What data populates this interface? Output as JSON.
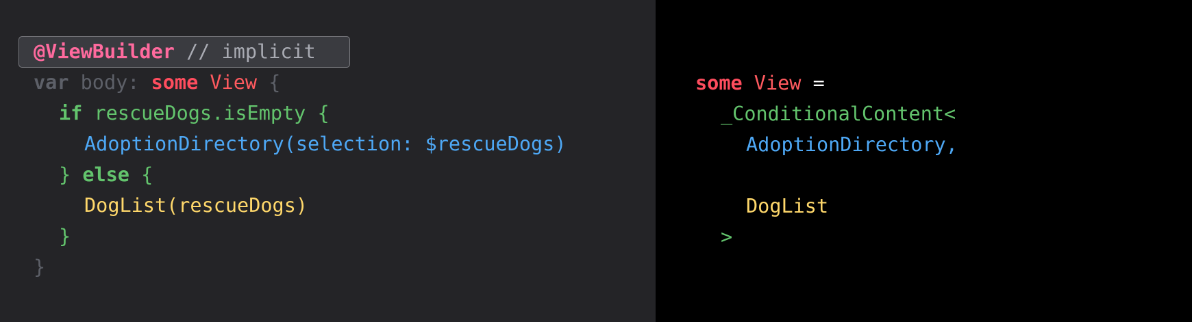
{
  "colors": {
    "left_background": "#242427",
    "right_background": "#000000",
    "keyword_pink": "#ff6a9e",
    "keyword_red": "#ff4d5e",
    "type_red": "#ff5a5f",
    "green": "#63c46d",
    "blue": "#4ea8f5",
    "yellow": "#ffd86b",
    "dim_gray": "#5d6068",
    "comment_gray": "#a9abb3",
    "white": "#ffffff"
  },
  "left_code": {
    "lines": [
      {
        "indent": 0,
        "tokens": [
          {
            "text": "@ViewBuilder",
            "color": "#ff6a9e",
            "bold": true
          },
          {
            "text": " // implicit",
            "color": "#a9abb3",
            "bold": false
          }
        ]
      },
      {
        "indent": 0,
        "tokens": [
          {
            "text": "var",
            "color": "#5d6068",
            "bold": true
          },
          {
            "text": " body: ",
            "color": "#5d6068",
            "bold": false
          },
          {
            "text": "some",
            "color": "#ff4d5e",
            "bold": true
          },
          {
            "text": " View",
            "color": "#ff5a5f",
            "bold": false
          },
          {
            "text": " {",
            "color": "#5d6068",
            "bold": false
          }
        ]
      },
      {
        "indent": 1,
        "tokens": [
          {
            "text": "if",
            "color": "#63c46d",
            "bold": true
          },
          {
            "text": " rescueDogs.isEmpty {",
            "color": "#63c46d",
            "bold": false
          }
        ]
      },
      {
        "indent": 2,
        "tokens": [
          {
            "text": "AdoptionDirectory(selection: $rescueDogs)",
            "color": "#4ea8f5",
            "bold": false
          }
        ]
      },
      {
        "indent": 1,
        "tokens": [
          {
            "text": "} ",
            "color": "#63c46d",
            "bold": false
          },
          {
            "text": "else",
            "color": "#63c46d",
            "bold": true
          },
          {
            "text": " {",
            "color": "#63c46d",
            "bold": false
          }
        ]
      },
      {
        "indent": 2,
        "tokens": [
          {
            "text": "DogList(rescueDogs)",
            "color": "#ffd86b",
            "bold": false
          }
        ]
      },
      {
        "indent": 1,
        "tokens": [
          {
            "text": "}",
            "color": "#63c46d",
            "bold": false
          }
        ]
      },
      {
        "indent": 0,
        "tokens": [
          {
            "text": "}",
            "color": "#5d6068",
            "bold": false
          }
        ]
      }
    ]
  },
  "right_code": {
    "lines": [
      {
        "indent": 0,
        "tokens": [
          {
            "text": "some",
            "color": "#ff4d5e",
            "bold": true
          },
          {
            "text": " View",
            "color": "#ff5a5f",
            "bold": false
          },
          {
            "text": " =",
            "color": "#ffffff",
            "bold": false
          }
        ]
      },
      {
        "indent": 1,
        "tokens": [
          {
            "text": "_ConditionalContent<",
            "color": "#63c46d",
            "bold": false
          }
        ]
      },
      {
        "indent": 2,
        "tokens": [
          {
            "text": "AdoptionDirectory,",
            "color": "#4ea8f5",
            "bold": false
          }
        ]
      },
      {
        "indent": 2,
        "tokens": []
      },
      {
        "indent": 2,
        "tokens": [
          {
            "text": "DogList",
            "color": "#ffd86b",
            "bold": false
          }
        ]
      },
      {
        "indent": 1,
        "tokens": [
          {
            "text": ">",
            "color": "#63c46d",
            "bold": false
          }
        ]
      }
    ]
  }
}
